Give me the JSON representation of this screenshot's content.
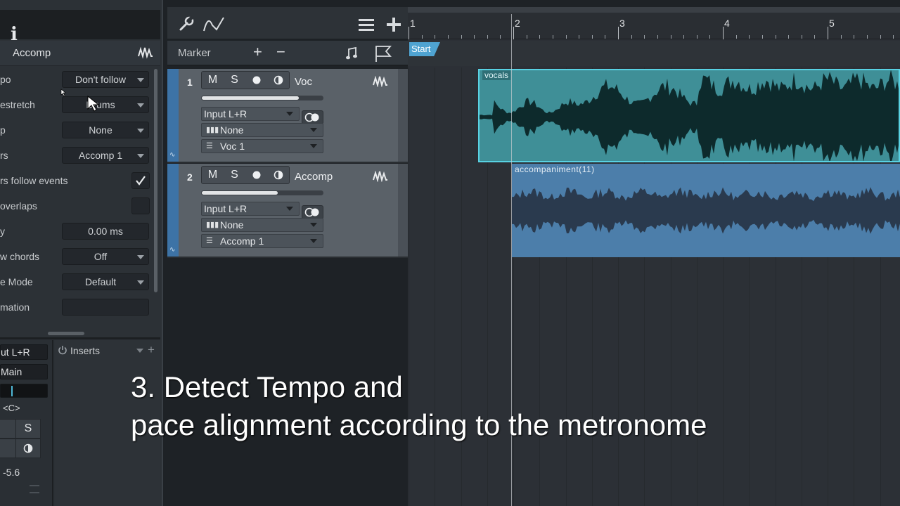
{
  "inspector": {
    "info_icon": "i",
    "track_name": "Accomp",
    "rows": [
      {
        "label": "po",
        "value": "Don't follow"
      },
      {
        "label": "estretch",
        "value": "Drums"
      },
      {
        "label": "p",
        "value": "None"
      },
      {
        "label": "rs",
        "value": "Accomp 1"
      },
      {
        "label": "rs follow events",
        "checked": true
      },
      {
        "label": "overlaps",
        "checked": false
      },
      {
        "label": "y",
        "value": "0.00 ms"
      },
      {
        "label": "w chords",
        "value": "Off"
      },
      {
        "label": "e Mode",
        "value": "Default"
      },
      {
        "label": "mation",
        "value": ""
      }
    ],
    "channel": {
      "input": "ut L+R",
      "output": "Main",
      "pan": "<C>",
      "solo": "S",
      "volume": "-5.6"
    },
    "inserts_label": "Inserts"
  },
  "toolbar": {
    "marker_label": "Marker",
    "add": "+",
    "remove": "−"
  },
  "tracks": [
    {
      "number": "1",
      "name": "Voc",
      "mute": "M",
      "solo": "S",
      "input": "Input L+R",
      "instrument": "None",
      "layer": "Voc 1",
      "volume_fraction": 0.8
    },
    {
      "number": "2",
      "name": "Accomp",
      "mute": "M",
      "solo": "S",
      "input": "Input L+R",
      "instrument": "None",
      "layer": "Accomp 1",
      "volume_fraction": 0.63
    }
  ],
  "ruler": {
    "bars": [
      "1",
      "2",
      "3",
      "4",
      "5"
    ]
  },
  "marker_lane": {
    "start_label": "Start"
  },
  "clips": {
    "vocals": "vocals",
    "accomp": "accompaniment(11)"
  },
  "caption": {
    "line1": "3. Detect Tempo and",
    "line2": "pace alignment according to the metronome"
  },
  "colors": {
    "track_stripe": "#3d73a6",
    "vocals_clip": "#3f8f97",
    "vocals_border": "#58d2e3",
    "accomp_clip": "#4c7eaa"
  }
}
